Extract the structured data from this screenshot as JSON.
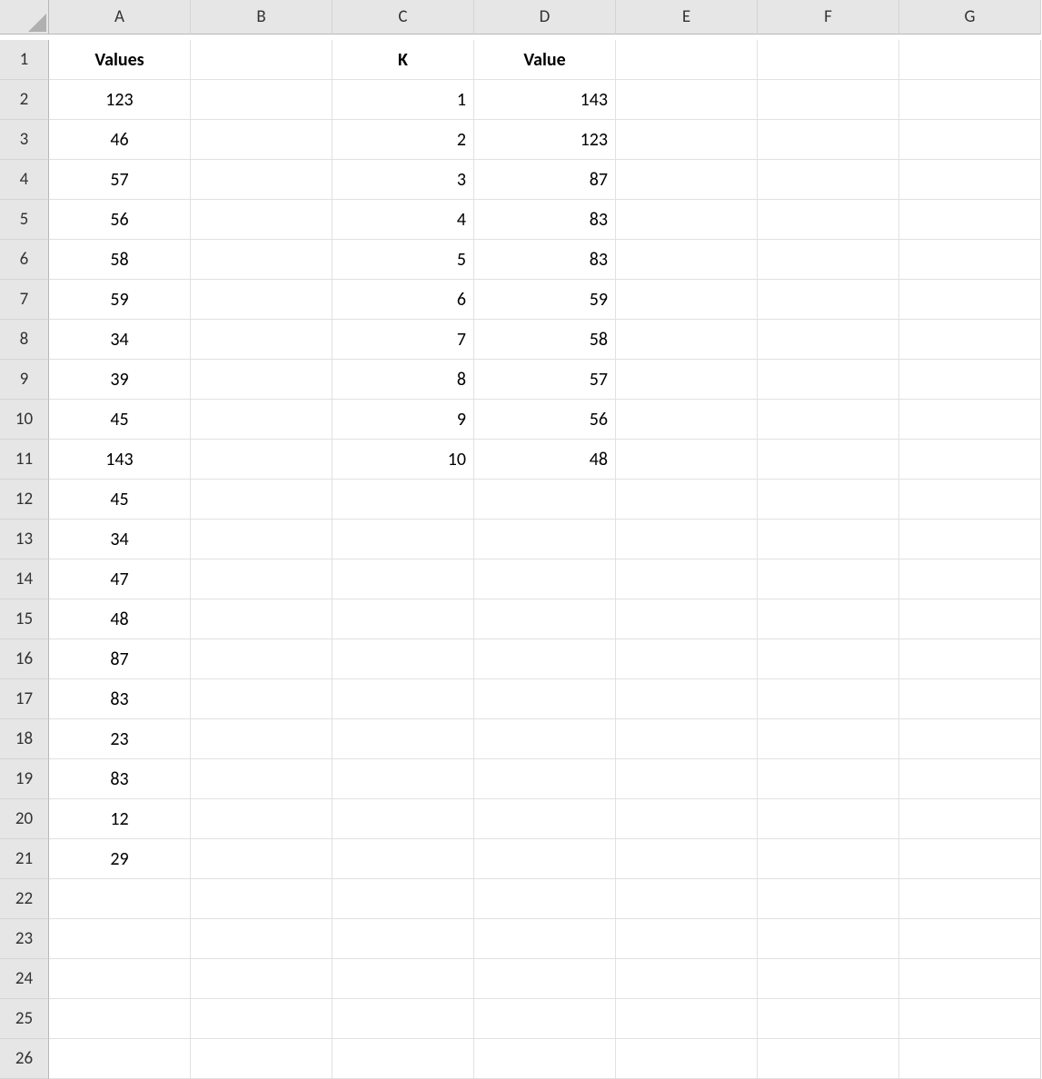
{
  "columns": [
    "A",
    "B",
    "C",
    "D",
    "E",
    "F",
    "G"
  ],
  "rowCount": 26,
  "headers": {
    "A1": "Values",
    "C1": "K",
    "D1": "Value"
  },
  "colA": [
    "123",
    "46",
    "57",
    "56",
    "58",
    "59",
    "34",
    "39",
    "45",
    "143",
    "45",
    "34",
    "47",
    "48",
    "87",
    "83",
    "23",
    "83",
    "12",
    "29"
  ],
  "colC": [
    "1",
    "2",
    "3",
    "4",
    "5",
    "6",
    "7",
    "8",
    "9",
    "10"
  ],
  "colD": [
    "143",
    "123",
    "87",
    "83",
    "83",
    "59",
    "58",
    "57",
    "56",
    "48"
  ]
}
